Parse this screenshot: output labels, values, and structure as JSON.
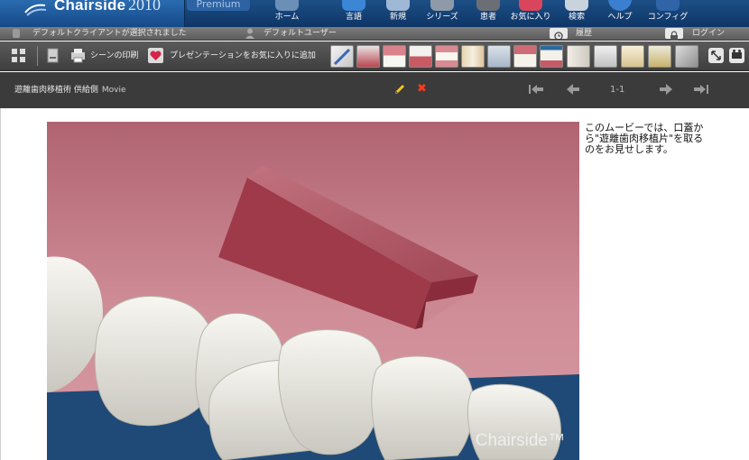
{
  "app": {
    "logo_text": "Chairside",
    "logo_year": "2010",
    "edition": "Premium"
  },
  "nav": [
    {
      "label": "ホーム",
      "icon": "home-icon"
    },
    {
      "label": "言語",
      "icon": "language-icon"
    },
    {
      "label": "新規",
      "icon": "new-icon"
    },
    {
      "label": "シリーズ",
      "icon": "series-icon"
    },
    {
      "label": "患者",
      "icon": "patient-icon"
    },
    {
      "label": "お気に入り",
      "icon": "favorites-icon"
    },
    {
      "label": "検索",
      "icon": "search-icon"
    },
    {
      "label": "ヘルプ",
      "icon": "help-icon"
    },
    {
      "label": "コンフィグ",
      "icon": "config-icon"
    }
  ],
  "infobar": {
    "client_status": "デフォルトクライアントが選択されました",
    "user": "デフォルトユーザー",
    "history": "履歴",
    "login": "ログイン"
  },
  "toolbar": {
    "print_label": "シーンの印刷",
    "favorite_label": "プレゼンテーションをお気に入りに追加"
  },
  "scene": {
    "title": "遊離歯肉移植術 供給側",
    "media": "Movie",
    "page": "1-1"
  },
  "caption": "このムービーでは、口蓋から\"遊離歯肉移植片\"を取るのをお見せします。",
  "watermark": "Chairside™",
  "colors": {
    "header_blue": "#1d4f86",
    "toolbar_gray": "#4a4a4a",
    "scene_bar": "#3b3b3b",
    "gum_pink": "#c07a84",
    "graft_red": "#a83a48"
  }
}
